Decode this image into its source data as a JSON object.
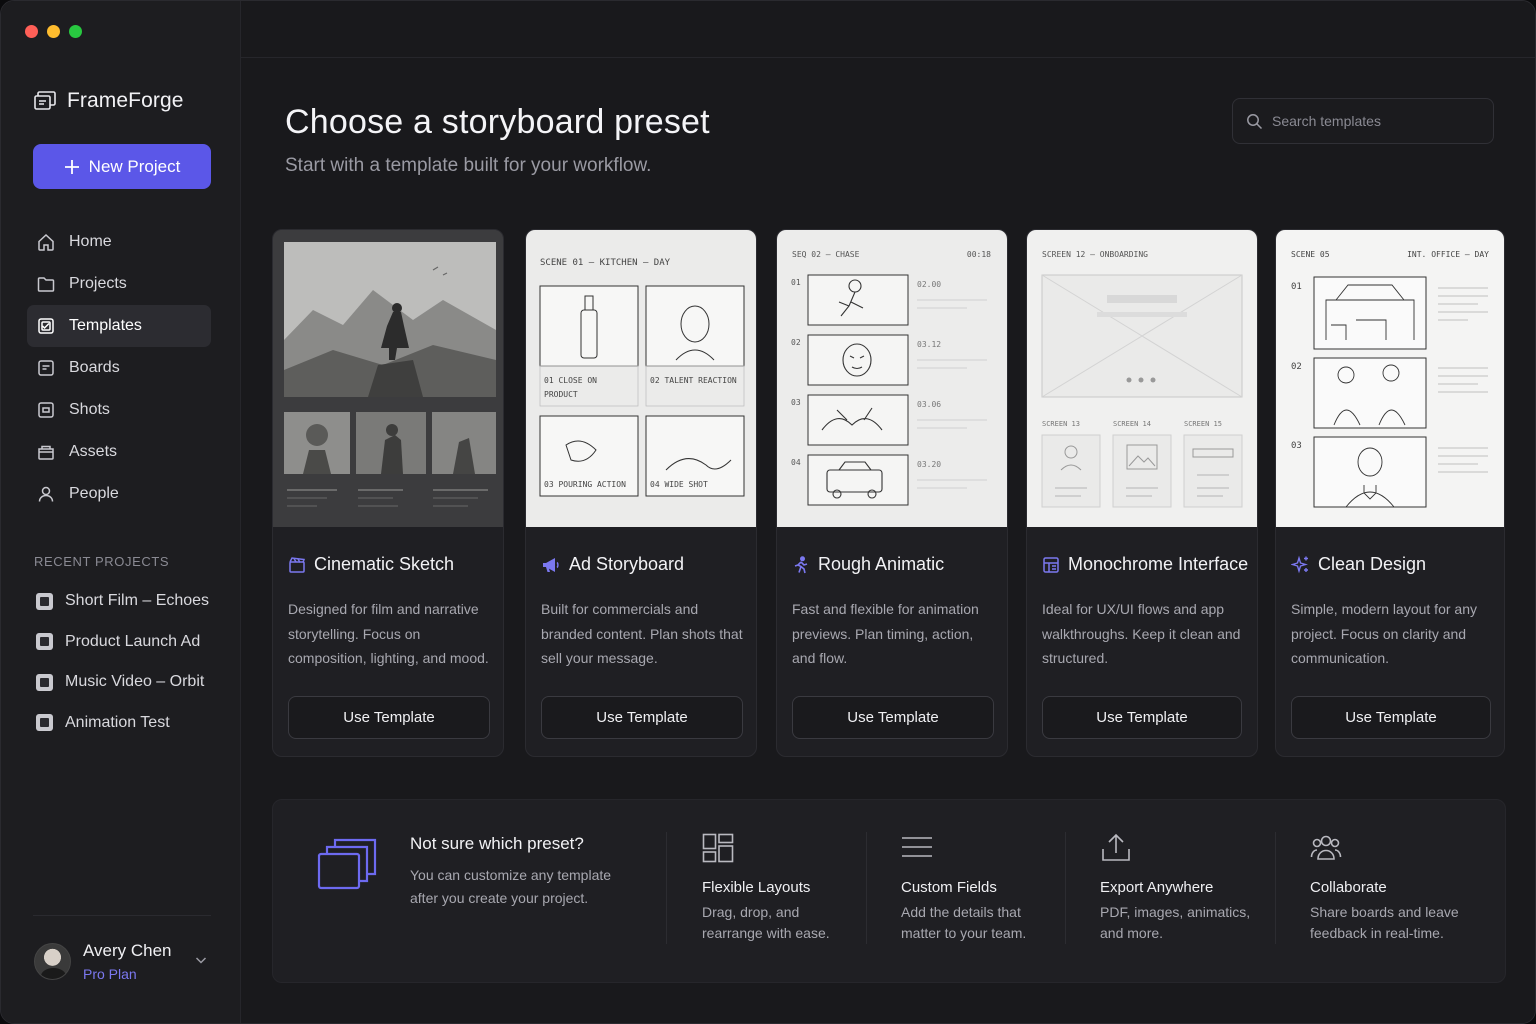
{
  "app": {
    "name": "FrameForge"
  },
  "sidebar": {
    "new_project_label": "New Project",
    "nav": [
      {
        "label": "Home",
        "icon": "home-icon"
      },
      {
        "label": "Projects",
        "icon": "folder-icon"
      },
      {
        "label": "Templates",
        "icon": "templates-icon",
        "active": true
      },
      {
        "label": "Boards",
        "icon": "board-icon"
      },
      {
        "label": "Shots",
        "icon": "shot-icon"
      },
      {
        "label": "Assets",
        "icon": "assets-icon"
      },
      {
        "label": "People",
        "icon": "person-icon"
      }
    ],
    "recent_heading": "RECENT PROJECTS",
    "recent": [
      {
        "label": "Short Film – Echoes"
      },
      {
        "label": "Product Launch Ad"
      },
      {
        "label": "Music Video – Orbit"
      },
      {
        "label": "Animation Test"
      }
    ],
    "user": {
      "name": "Avery Chen",
      "plan": "Pro Plan"
    }
  },
  "main": {
    "title": "Choose a storyboard preset",
    "subtitle": "Start with a template built for your workflow.",
    "search_placeholder": "Search templates",
    "use_template_label": "Use Template",
    "cards": [
      {
        "title": "Cinematic Sketch",
        "icon": "clapperboard-icon",
        "desc": "Designed for film and narrative storytelling. Focus on composition, lighting, and mood."
      },
      {
        "title": "Ad Storyboard",
        "icon": "megaphone-icon",
        "desc": "Built for commercials and branded content. Plan shots that sell your message.",
        "preview": {
          "header": "SCENE 01 – KITCHEN – DAY",
          "panels": [
            "01  CLOSE ON PRODUCT",
            "02  TALENT REACTION",
            "03  POURING ACTION",
            "04  WIDE SHOT"
          ]
        }
      },
      {
        "title": "Rough Animatic",
        "icon": "running-figure-icon",
        "desc": "Fast and flexible for animation previews. Plan timing, action, and flow.",
        "preview": {
          "header_left": "SEQ 02 – CHASE",
          "header_right": "00:18",
          "rows": [
            {
              "num": "01",
              "time": "02.00"
            },
            {
              "num": "02",
              "time": "03.12"
            },
            {
              "num": "03",
              "time": "03.06"
            },
            {
              "num": "04",
              "time": "03.20"
            }
          ]
        }
      },
      {
        "title": "Monochrome Interface",
        "icon": "layout-icon",
        "desc": "Ideal for UX/UI flows and app walkthroughs. Keep it clean and structured.",
        "preview": {
          "header": "SCREEN 12 – ONBOARDING",
          "screens": [
            "SCREEN 13",
            "SCREEN 14",
            "SCREEN 15"
          ]
        }
      },
      {
        "title": "Clean Design",
        "icon": "sparkle-icon",
        "desc": "Simple, modern layout for any project. Focus on clarity and communication.",
        "preview": {
          "header_left": "SCENE 05",
          "header_right": "INT. OFFICE – DAY",
          "rows": [
            "01",
            "02",
            "03"
          ]
        }
      }
    ],
    "help": {
      "title": "Not sure which preset?",
      "text": "You can customize any template after you create your project."
    },
    "features": [
      {
        "title": "Flexible Layouts",
        "text": "Drag, drop, and rearrange with ease.",
        "icon": "layout-grid-icon"
      },
      {
        "title": "Custom Fields",
        "text": "Add the details that matter to your team.",
        "icon": "lines-icon"
      },
      {
        "title": "Export Anywhere",
        "text": "PDF, images, animatics, and more.",
        "icon": "upload-icon"
      },
      {
        "title": "Collaborate",
        "text": "Share boards and leave feedback in real-time.",
        "icon": "people-icon"
      }
    ]
  },
  "colors": {
    "accent": "#5b57e8",
    "plan": "#7b78f0",
    "background": "#19191c",
    "card": "#1f1f23"
  }
}
